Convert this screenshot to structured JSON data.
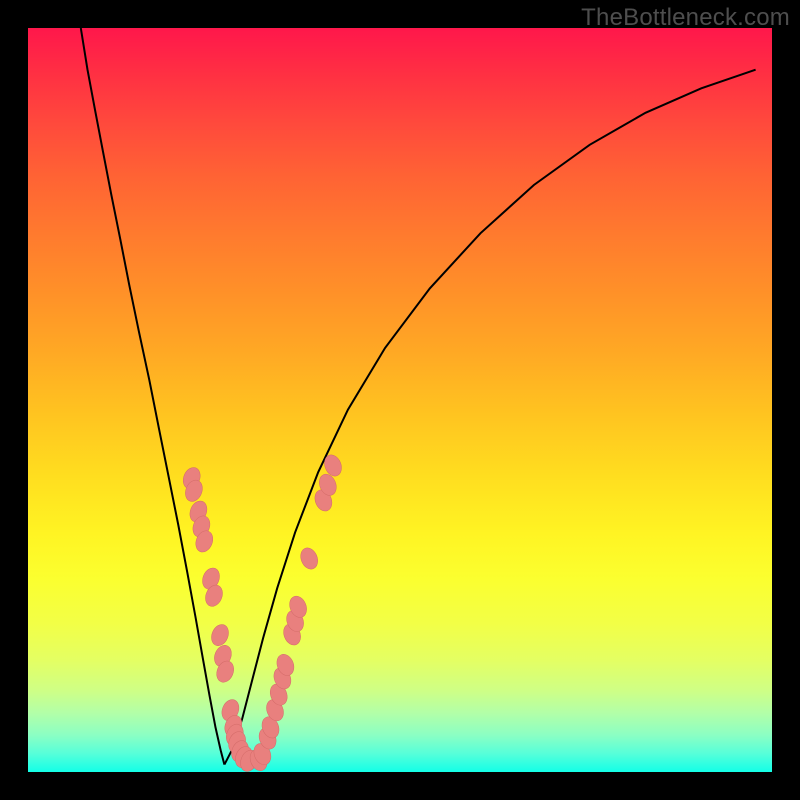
{
  "watermark": "TheBottleneck.com",
  "colors": {
    "curve": "#000000",
    "marker_fill": "#e9807e",
    "marker_stroke": "#d46b69"
  },
  "chart_data": {
    "type": "line",
    "title": "",
    "xlabel": "",
    "ylabel": "",
    "xlim": [
      0,
      1
    ],
    "ylim": [
      0,
      1
    ],
    "gradient_meaning": "vertical heat gradient, red (top) → green (bottom); curves represent bottleneck mismatch vs. component ratio",
    "series": [
      {
        "name": "left-branch",
        "x": [
          0.071,
          0.08,
          0.09,
          0.101,
          0.112,
          0.124,
          0.136,
          0.149,
          0.163,
          0.176,
          0.189,
          0.202,
          0.214,
          0.225,
          0.235,
          0.244,
          0.252,
          0.259,
          0.264
        ],
        "y": [
          1.0,
          0.944,
          0.89,
          0.833,
          0.776,
          0.716,
          0.655,
          0.592,
          0.527,
          0.462,
          0.397,
          0.332,
          0.269,
          0.209,
          0.153,
          0.103,
          0.06,
          0.029,
          0.01
        ]
      },
      {
        "name": "right-branch",
        "x": [
          0.264,
          0.276,
          0.288,
          0.301,
          0.316,
          0.335,
          0.359,
          0.39,
          0.43,
          0.48,
          0.54,
          0.608,
          0.68,
          0.755,
          0.83,
          0.905,
          0.978
        ],
        "y": [
          0.01,
          0.033,
          0.072,
          0.122,
          0.18,
          0.247,
          0.322,
          0.403,
          0.487,
          0.57,
          0.65,
          0.724,
          0.789,
          0.843,
          0.886,
          0.919,
          0.944
        ]
      }
    ],
    "markers": [
      {
        "branch": "left",
        "x": 0.22,
        "y": 0.395
      },
      {
        "branch": "left",
        "x": 0.223,
        "y": 0.378
      },
      {
        "branch": "left",
        "x": 0.229,
        "y": 0.35
      },
      {
        "branch": "left",
        "x": 0.233,
        "y": 0.33
      },
      {
        "branch": "left",
        "x": 0.237,
        "y": 0.31
      },
      {
        "branch": "left",
        "x": 0.246,
        "y": 0.26
      },
      {
        "branch": "left",
        "x": 0.25,
        "y": 0.237
      },
      {
        "branch": "left",
        "x": 0.258,
        "y": 0.184
      },
      {
        "branch": "left",
        "x": 0.262,
        "y": 0.156
      },
      {
        "branch": "left",
        "x": 0.265,
        "y": 0.135
      },
      {
        "branch": "left",
        "x": 0.272,
        "y": 0.083
      },
      {
        "branch": "left",
        "x": 0.276,
        "y": 0.062
      },
      {
        "branch": "left",
        "x": 0.278,
        "y": 0.05
      },
      {
        "branch": "left",
        "x": 0.281,
        "y": 0.04
      },
      {
        "branch": "left",
        "x": 0.285,
        "y": 0.028
      },
      {
        "branch": "left",
        "x": 0.29,
        "y": 0.02
      },
      {
        "branch": "left",
        "x": 0.297,
        "y": 0.015
      },
      {
        "branch": "right",
        "x": 0.31,
        "y": 0.016
      },
      {
        "branch": "right",
        "x": 0.315,
        "y": 0.024
      },
      {
        "branch": "right",
        "x": 0.322,
        "y": 0.045
      },
      {
        "branch": "right",
        "x": 0.326,
        "y": 0.06
      },
      {
        "branch": "right",
        "x": 0.332,
        "y": 0.083
      },
      {
        "branch": "right",
        "x": 0.337,
        "y": 0.104
      },
      {
        "branch": "right",
        "x": 0.342,
        "y": 0.126
      },
      {
        "branch": "right",
        "x": 0.346,
        "y": 0.144
      },
      {
        "branch": "right",
        "x": 0.355,
        "y": 0.185
      },
      {
        "branch": "right",
        "x": 0.359,
        "y": 0.203
      },
      {
        "branch": "right",
        "x": 0.363,
        "y": 0.222
      },
      {
        "branch": "right",
        "x": 0.378,
        "y": 0.287
      },
      {
        "branch": "right",
        "x": 0.397,
        "y": 0.365
      },
      {
        "branch": "right",
        "x": 0.403,
        "y": 0.386
      },
      {
        "branch": "right",
        "x": 0.41,
        "y": 0.412
      }
    ]
  }
}
